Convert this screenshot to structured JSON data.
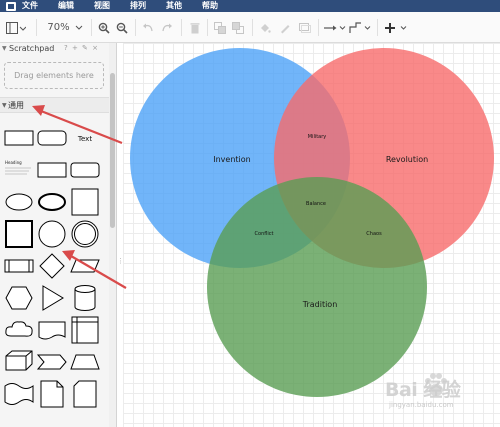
{
  "menubar": {
    "items": [
      "文件",
      "编辑",
      "视图",
      "排列",
      "其他",
      "帮助"
    ]
  },
  "toolbar": {
    "zoom": "70%",
    "icons": [
      "view-panels-icon",
      "zoom-in-icon",
      "zoom-out-icon",
      "undo-icon",
      "redo-icon",
      "delete-icon",
      "to-front-icon",
      "to-back-icon",
      "fill-color-icon",
      "line-color-icon",
      "shadow-icon",
      "connection-style-icon",
      "waypoint-style-icon",
      "insert-icon"
    ]
  },
  "sidebar": {
    "scratchpad_title": "Scratchpad",
    "scratchpad_actions": "? + ✎ ×",
    "dropzone_text": "Drag elements here",
    "general_title": "通用",
    "shapes": [
      {
        "name": "rectangle-shape"
      },
      {
        "name": "rounded-rectangle-shape"
      },
      {
        "name": "text-shape",
        "label": "Text"
      },
      {
        "name": "textbox-shape",
        "label": "Heading"
      },
      {
        "name": "rect-alt-shape"
      },
      {
        "name": "rounded-alt-shape"
      },
      {
        "name": "ellipse-shape"
      },
      {
        "name": "ellipse-thick-shape"
      },
      {
        "name": "square-shape"
      },
      {
        "name": "square-thick-shape"
      },
      {
        "name": "circle-shape"
      },
      {
        "name": "double-circle-shape"
      },
      {
        "name": "process-shape"
      },
      {
        "name": "diamond-shape"
      },
      {
        "name": "parallelogram-shape"
      },
      {
        "name": "hexagon-shape"
      },
      {
        "name": "triangle-shape"
      },
      {
        "name": "cylinder-shape"
      },
      {
        "name": "cloud-shape"
      },
      {
        "name": "document-shape"
      },
      {
        "name": "internal-storage-shape"
      },
      {
        "name": "cube-shape"
      },
      {
        "name": "step-shape"
      },
      {
        "name": "trapezoid-shape"
      },
      {
        "name": "tape-shape"
      },
      {
        "name": "note-shape"
      },
      {
        "name": "card-shape"
      }
    ]
  },
  "diagram": {
    "circles": [
      {
        "name": "invention-circle",
        "label": "Invention",
        "color": "#4da3f7"
      },
      {
        "name": "revolution-circle",
        "label": "Revolution",
        "color": "#f76b6b"
      },
      {
        "name": "tradition-circle",
        "label": "Tradition",
        "color": "#5a9e54"
      }
    ],
    "overlaps": {
      "top": "Military",
      "center": "Balance",
      "left": "Conflict",
      "right": "Chaos"
    }
  },
  "watermark": {
    "brand": "Bai  经验",
    "sub": "jingyan.baidu.com"
  },
  "colors": {
    "menubar": "#2f4d7b",
    "arrow": "#d94b4b"
  }
}
